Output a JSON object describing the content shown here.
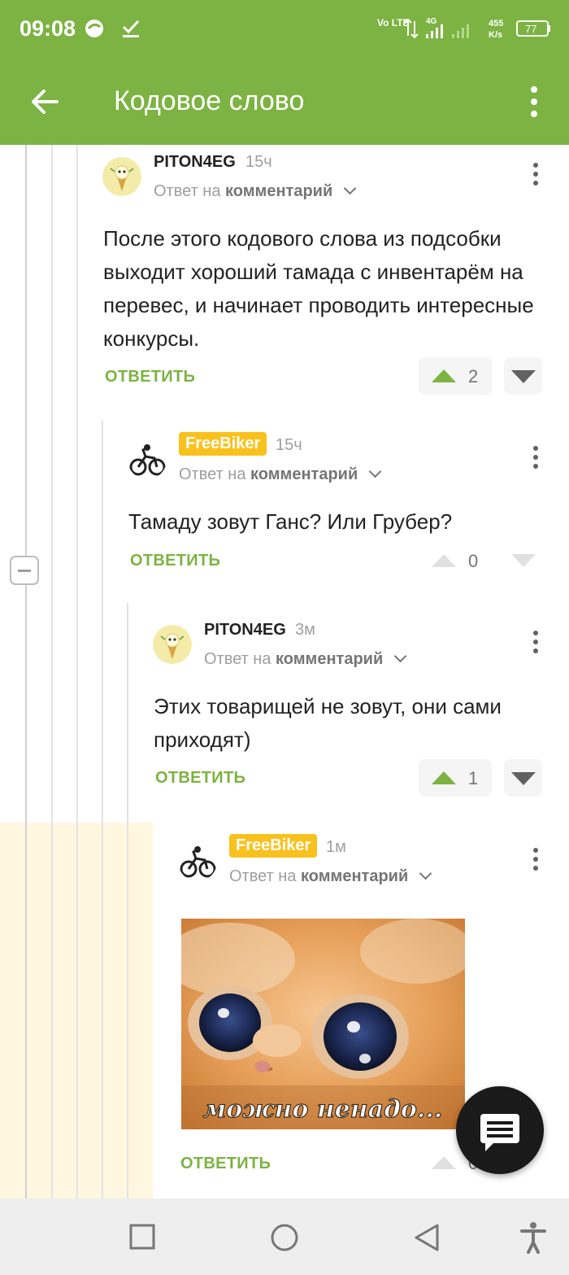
{
  "status_bar": {
    "time": "09:08",
    "network": "Vo LTE",
    "signal": "4G",
    "speed_value": "455",
    "speed_unit": "K/s",
    "battery": "77"
  },
  "app_bar": {
    "title": "Кодовое слово",
    "back_icon": "arrow-left-icon",
    "menu_icon": "more-vert-icon"
  },
  "comments": [
    {
      "author": "PITON4EG",
      "time": "15ч",
      "reply_prefix": "Ответ на",
      "reply_link": "комментарий",
      "text": "После этого кодового слова из подсобки выходит хороший тамада с инвентарём на перевес, и начинает проводить интересные конкурсы.",
      "reply_label": "ОТВЕТИТЬ",
      "votes": "2"
    },
    {
      "author": "FreeBiker",
      "time": "15ч",
      "reply_prefix": "Ответ на",
      "reply_link": "комментарий",
      "text": "Тамаду зовут Ганс? Или Грубер?",
      "reply_label": "ОТВЕТИТЬ",
      "votes": "0"
    },
    {
      "author": "PITON4EG",
      "time": "3м",
      "reply_prefix": "Ответ на",
      "reply_link": "комментарий",
      "text": "Этих товарищей не зовут, они сами приходят)",
      "reply_label": "ОТВЕТИТЬ",
      "votes": "1"
    },
    {
      "author": "FreeBiker",
      "time": "1м",
      "reply_prefix": "Ответ на",
      "reply_link": "комментарий",
      "image_caption": "можно ненадо...",
      "reply_label": "ОТВЕТИТЬ",
      "votes": "0"
    }
  ],
  "fab_icon": "comment-icon",
  "nav_bar": [
    "recent-apps-icon",
    "home-icon",
    "back-icon",
    "accessibility-icon"
  ],
  "colors": {
    "brand": "#7cb342",
    "badge": "#f9c11d",
    "highlight": "#fff7e0"
  }
}
